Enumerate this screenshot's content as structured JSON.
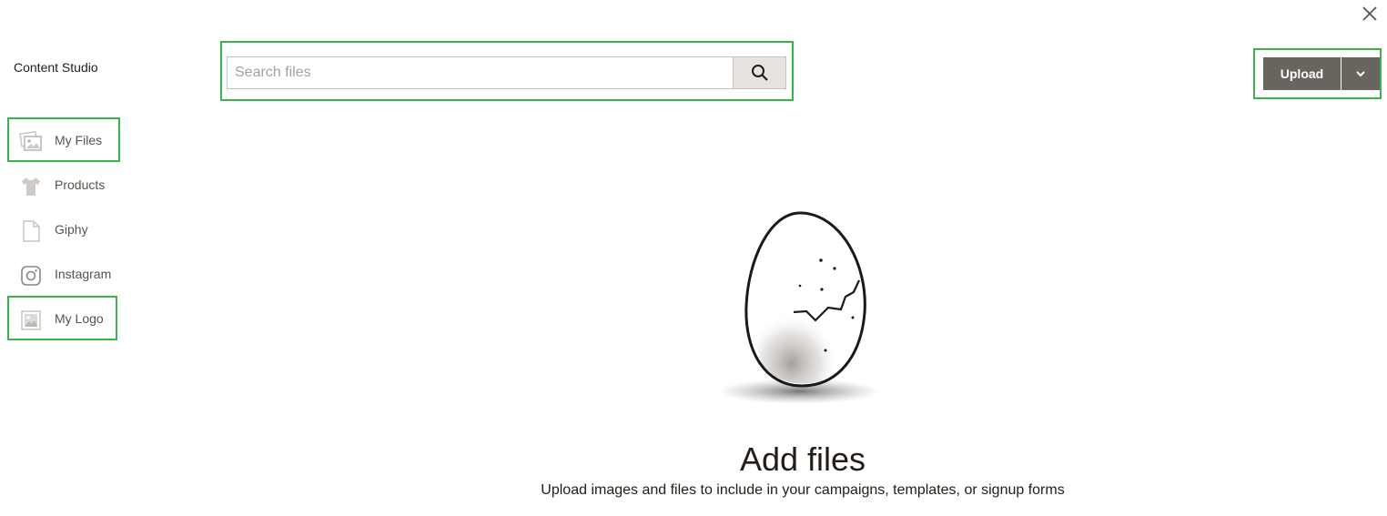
{
  "app": {
    "title": "Content Studio",
    "close_icon": "close-icon"
  },
  "sidebar": {
    "items": [
      {
        "label": "My Files",
        "icon": "images-icon"
      },
      {
        "label": "Products",
        "icon": "tshirt-icon"
      },
      {
        "label": "Giphy",
        "icon": "document-icon"
      },
      {
        "label": "Instagram",
        "icon": "instagram-icon"
      },
      {
        "label": "My Logo",
        "icon": "logo-image-icon"
      }
    ]
  },
  "search": {
    "placeholder": "Search files",
    "value": "",
    "icon": "search-icon"
  },
  "toolbar": {
    "upload_label": "Upload",
    "dropdown_icon": "chevron-down-icon"
  },
  "empty_state": {
    "illustration": "cracked-egg-illustration",
    "title": "Add files",
    "subtitle": "Upload images and files to include in your campaigns, templates, or signup forms"
  },
  "colors": {
    "highlight": "#3ab54a",
    "button": "#6a645f",
    "text": "#241c15",
    "muted_text": "#5a5149"
  }
}
